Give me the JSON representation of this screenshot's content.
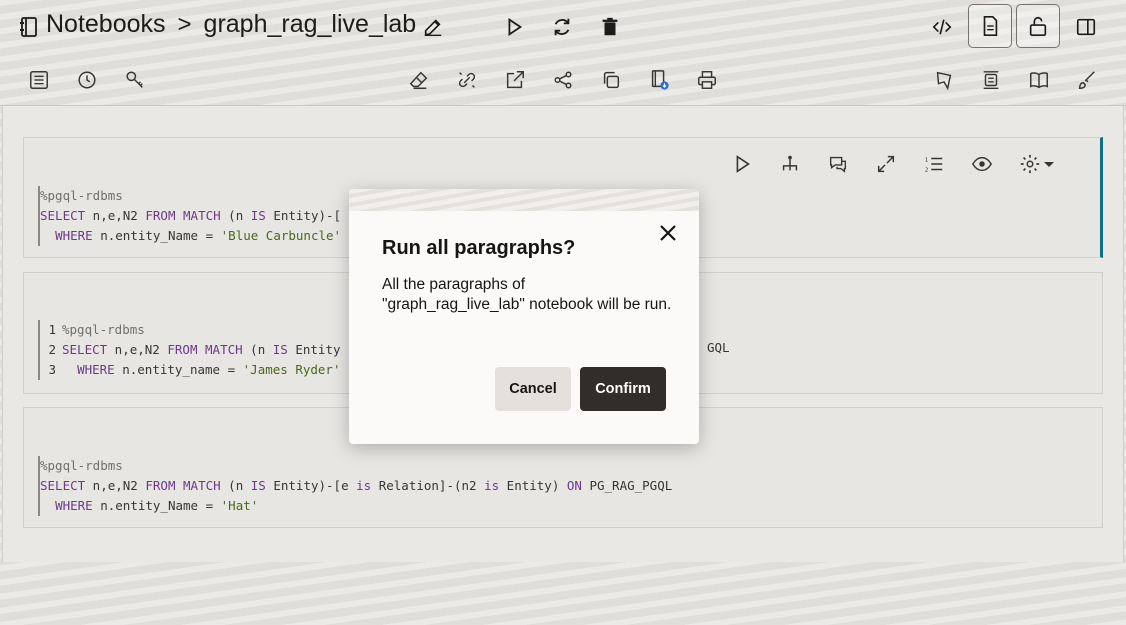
{
  "breadcrumb": {
    "root": "Notebooks",
    "separator": ">",
    "notebook": "graph_rag_live_lab"
  },
  "paragraphs": [
    {
      "lines": [
        {
          "num": "",
          "parts": [
            [
              "dim",
              "%pgql-rdbms"
            ]
          ]
        },
        {
          "num": "",
          "parts": [
            [
              "kw",
              "SELECT"
            ],
            [
              "",
              " n,e,N2 "
            ],
            [
              "kw",
              "FROM"
            ],
            [
              "",
              " "
            ],
            [
              "kw",
              "MATCH"
            ],
            [
              "",
              " (n "
            ],
            [
              "kw",
              "IS"
            ],
            [
              "",
              " Entity)-["
            ]
          ]
        },
        {
          "num": "",
          "parts": [
            [
              "",
              "  "
            ],
            [
              "kw",
              "WHERE"
            ],
            [
              "",
              " n.entity_Name = "
            ],
            [
              "str",
              "'Blue Carbuncle'"
            ]
          ]
        }
      ]
    },
    {
      "lines": [
        {
          "num": "1",
          "parts": [
            [
              "dim",
              "%pgql-rdbms"
            ]
          ]
        },
        {
          "num": "2",
          "parts": [
            [
              "kw",
              "SELECT"
            ],
            [
              "",
              " n,e,N2 "
            ],
            [
              "kw",
              "FROM"
            ],
            [
              "",
              " "
            ],
            [
              "kw",
              "MATCH"
            ],
            [
              "",
              " (n "
            ],
            [
              "kw",
              "IS"
            ],
            [
              "",
              " Entity"
            ]
          ]
        },
        {
          "num": "3",
          "parts": [
            [
              "",
              "  "
            ],
            [
              "kw",
              "WHERE"
            ],
            [
              "",
              " n.entity_name = "
            ],
            [
              "str",
              "'James Ryder'"
            ]
          ]
        }
      ],
      "tail_text": "GQL"
    },
    {
      "lines": [
        {
          "num": "",
          "parts": [
            [
              "dim",
              "%pgql-rdbms"
            ]
          ]
        },
        {
          "num": "",
          "parts": [
            [
              "kw",
              "SELECT"
            ],
            [
              "",
              " n,e,N2 "
            ],
            [
              "kw",
              "FROM"
            ],
            [
              "",
              " "
            ],
            [
              "kw",
              "MATCH"
            ],
            [
              "",
              " (n "
            ],
            [
              "kw",
              "IS"
            ],
            [
              "",
              " Entity)-[e "
            ],
            [
              "kw",
              "is"
            ],
            [
              "",
              " Relation]-(n2 "
            ],
            [
              "kw",
              "is"
            ],
            [
              "",
              " Entity) "
            ],
            [
              "kw",
              "ON"
            ],
            [
              "",
              " PG_RAG_PGQL"
            ]
          ]
        },
        {
          "num": "",
          "parts": [
            [
              "",
              "  "
            ],
            [
              "kw",
              "WHERE"
            ],
            [
              "",
              " n.entity_Name = "
            ],
            [
              "str",
              "'Hat'"
            ]
          ]
        }
      ]
    }
  ],
  "dialog": {
    "title": "Run all paragraphs?",
    "message": "All the paragraphs of \"graph_rag_live_lab\" notebook will be run.",
    "cancel_label": "Cancel",
    "confirm_label": "Confirm"
  },
  "colors": {
    "accent": "#0c7489",
    "confirm_bg": "#312d2a",
    "cancel_bg": "#e4e1dd"
  }
}
